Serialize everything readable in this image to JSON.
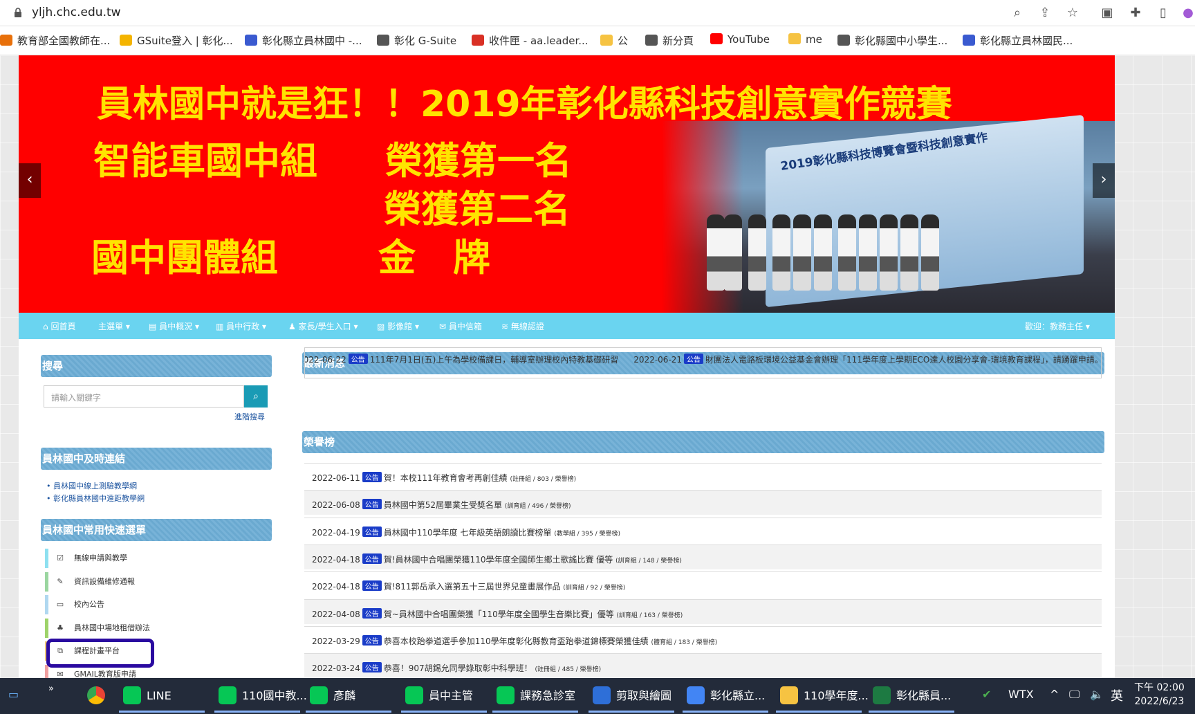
{
  "browser": {
    "url": "yljh.chc.edu.tw"
  },
  "bookmarks": [
    {
      "label": "教育部全國教師在...",
      "color": "#e8700a"
    },
    {
      "label": "GSuite登入 | 彰化...",
      "color": "#f4b400"
    },
    {
      "label": "彰化縣立員林國中 -...",
      "color": "#3a5ad0"
    },
    {
      "label": "彰化 G-Suite",
      "color": "#555"
    },
    {
      "label": "收件匣 - aa.leader...",
      "color": "#d93025"
    },
    {
      "label": "公",
      "color": "#f6c342"
    },
    {
      "label": "新分頁",
      "color": "#555"
    },
    {
      "label": "YouTube",
      "color": "#ff0000"
    },
    {
      "label": "me",
      "color": "#f6c342"
    },
    {
      "label": "彰化縣國中小學生...",
      "color": "#555"
    },
    {
      "label": "彰化縣立員林國民...",
      "color": "#3a5ad0"
    }
  ],
  "banner": {
    "line1": "員林國中就是狂！！2019年彰化縣科技創意實作競賽",
    "line2a": "智能車國中組",
    "line2b": "榮獲第一名",
    "line3": "榮獲第二名",
    "line4a": "國中團體組",
    "line4b": "金　牌",
    "stage": "2019彰化縣科技博覽會暨科技創意實作"
  },
  "nav": {
    "items": [
      "回首頁",
      "主選單",
      "員中概況",
      "員中行政",
      "家長/學生入口",
      "影像館",
      "員中信箱",
      "無線認證"
    ],
    "welcome": "歡迎：教務主任"
  },
  "sidebar": {
    "search_title": "搜尋",
    "search_placeholder": "請輸入關鍵字",
    "advanced": "進階搜尋",
    "links_title": "員林國中及時連結",
    "links": [
      "員林國中線上測驗教學網",
      "彰化縣員林國中遠距教學網"
    ],
    "menu_title": "員林國中常用快速選單",
    "menu": [
      {
        "label": "無線申請與教學",
        "icon": "☑",
        "bar": "#8ee0f0"
      },
      {
        "label": "資訊設備維修通報",
        "icon": "✎",
        "bar": "#9ad6a0"
      },
      {
        "label": "校內公告",
        "icon": "▭",
        "bar": "#b0d8f0"
      },
      {
        "label": "員林國中場地租借辦法",
        "icon": "♣",
        "bar": "#9ed36a"
      },
      {
        "label": "課程計畫平台",
        "icon": "⧉",
        "bar": "#f0c878"
      },
      {
        "label": "GMAIL教育版申請",
        "icon": "✉",
        "bar": "#f0a0a0"
      }
    ]
  },
  "news": {
    "title": "最新消息",
    "badge": "公告",
    "items": [
      {
        "date": "2022-06-22",
        "text": "111年7月1日(五)上午為學校備課日，輔導室辦理校內特教基礎研習"
      },
      {
        "date": "2022-06-21",
        "text": "財團法人電路板環境公益基金會辦理「111學年度上學期ECO達人校園分享會-環境教育課程」，請踴躍申請。"
      }
    ]
  },
  "honor": {
    "title": "榮譽榜",
    "rows": [
      {
        "date": "2022-06-11",
        "text": "賀！本校111年教育會考再創佳績",
        "meta": "(註冊組 / 803 / 榮譽榜)"
      },
      {
        "date": "2022-06-08",
        "text": "員林國中第52屆畢業生受獎名單",
        "meta": "(訓育組 / 496 / 榮譽榜)"
      },
      {
        "date": "2022-04-19",
        "text": "員林國中110學年度 七年級英語朗讀比賽榜單",
        "meta": "(教學組 / 395 / 榮譽榜)"
      },
      {
        "date": "2022-04-18",
        "text": "賀!員林國中合唱團榮獲110學年度全國師生鄉土歌謠比賽 優等",
        "meta": "(訓育組 / 148 / 榮譽榜)"
      },
      {
        "date": "2022-04-18",
        "text": "賀!811郭岳承入選第五十三屆世界兒童畫展作品",
        "meta": "(訓育組 / 92 / 榮譽榜)"
      },
      {
        "date": "2022-04-08",
        "text": "賀~員林國中合唱團榮獲「110學年度全國學生音樂比賽」優等",
        "meta": "(訓育組 / 163 / 榮譽榜)"
      },
      {
        "date": "2022-03-29",
        "text": "恭喜本校跆拳道選手參加110學年度彰化縣教育盃跆拳道錦標賽榮獲佳績",
        "meta": "(體育組 / 183 / 榮譽榜)"
      },
      {
        "date": "2022-03-24",
        "text": "恭喜！907胡錫允同學錄取彰中科學班！",
        "meta": "(註冊組 / 485 / 榮譽榜)"
      }
    ]
  },
  "taskbar": {
    "items": [
      "LINE",
      "110國中教...",
      "彥麟",
      "員中主管",
      "課務急診室",
      "剪取與繪圖",
      "彰化縣立...",
      "110學年度...",
      "彰化縣員..."
    ],
    "tray": "WTX",
    "lang": "英",
    "time": "下午 02:00",
    "date": "2022/6/23"
  }
}
